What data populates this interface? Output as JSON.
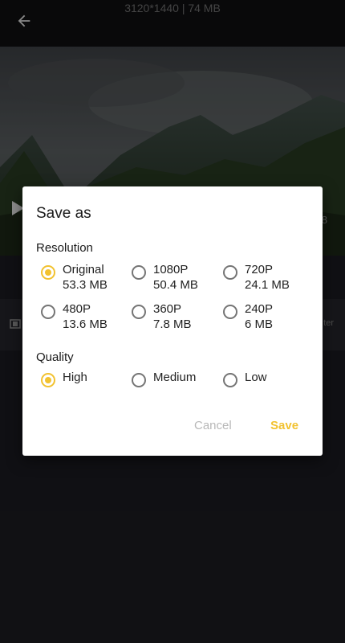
{
  "header": {
    "file_info": "3120*1440 | 74 MB"
  },
  "background": {
    "edge_number": "8",
    "strip_label": "ter"
  },
  "dialog": {
    "title": "Save as",
    "resolution_label": "Resolution",
    "resolutions": [
      {
        "name": "Original",
        "size": "53.3 MB",
        "selected": true
      },
      {
        "name": "1080P",
        "size": "50.4 MB",
        "selected": false
      },
      {
        "name": "720P",
        "size": "24.1 MB",
        "selected": false
      },
      {
        "name": "480P",
        "size": "13.6 MB",
        "selected": false
      },
      {
        "name": "360P",
        "size": "7.8 MB",
        "selected": false
      },
      {
        "name": "240P",
        "size": "6 MB",
        "selected": false
      }
    ],
    "quality_label": "Quality",
    "qualities": [
      {
        "name": "High",
        "selected": true
      },
      {
        "name": "Medium",
        "selected": false
      },
      {
        "name": "Low",
        "selected": false
      }
    ],
    "cancel_label": "Cancel",
    "save_label": "Save"
  },
  "colors": {
    "accent": "#f2c230",
    "radio_off": "#757575",
    "dialog_bg": "#ffffff",
    "app_bg": "#1a1a1f"
  },
  "icons": {
    "back": "arrow-left-icon",
    "play": "play-icon",
    "strip": "film-icon"
  }
}
